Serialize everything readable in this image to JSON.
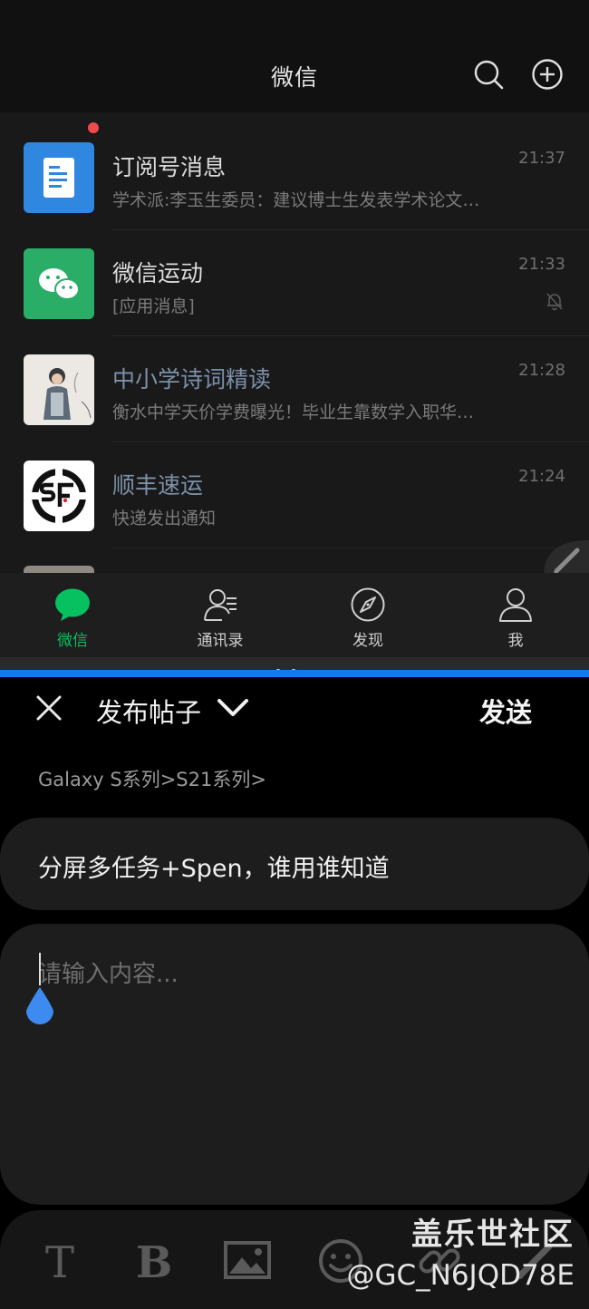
{
  "wechat": {
    "title": "微信",
    "chats": [
      {
        "name": "订阅号消息",
        "preview": "学术派:李玉生委员：建议博士生发表学术论文…",
        "time": "21:37",
        "name_style": "normal"
      },
      {
        "name": "微信运动",
        "preview": "[应用消息]",
        "time": "21:33",
        "name_style": "normal",
        "muted": true,
        "unread_dot": true
      },
      {
        "name": "中小学诗词精读",
        "preview": "衡水中学天价学费曝光！毕业生靠数学入职华…",
        "time": "21:28",
        "name_style": "official"
      },
      {
        "name": "顺丰速运",
        "preview": "快递发出通知",
        "time": "21:24",
        "name_style": "official"
      }
    ],
    "tabs": [
      {
        "label": "微信",
        "icon": "chat-bubble-icon",
        "active": true
      },
      {
        "label": "通讯录",
        "icon": "contacts-icon",
        "active": false
      },
      {
        "label": "发现",
        "icon": "compass-icon",
        "active": false
      },
      {
        "label": "我",
        "icon": "person-icon",
        "active": false
      }
    ],
    "colors": {
      "accent": "#07c160",
      "unread": "#f04b4b"
    }
  },
  "editor": {
    "title": "发布帖子",
    "send_label": "发送",
    "breadcrumb": "Galaxy S系列>S21系列>",
    "post_title": "分屏多任务+Spen，谁用谁知道",
    "content_placeholder": "请输入内容...",
    "toolbar": [
      "text-icon",
      "bold-icon",
      "image-icon",
      "emoji-icon",
      "link-icon",
      "pen-icon"
    ],
    "colors": {
      "split_focus": "#1877f2",
      "cursor_handle": "#3d8bf0"
    }
  },
  "watermark": {
    "line1": "盖乐世社区",
    "line2": "@GC_N6JQD78E"
  }
}
